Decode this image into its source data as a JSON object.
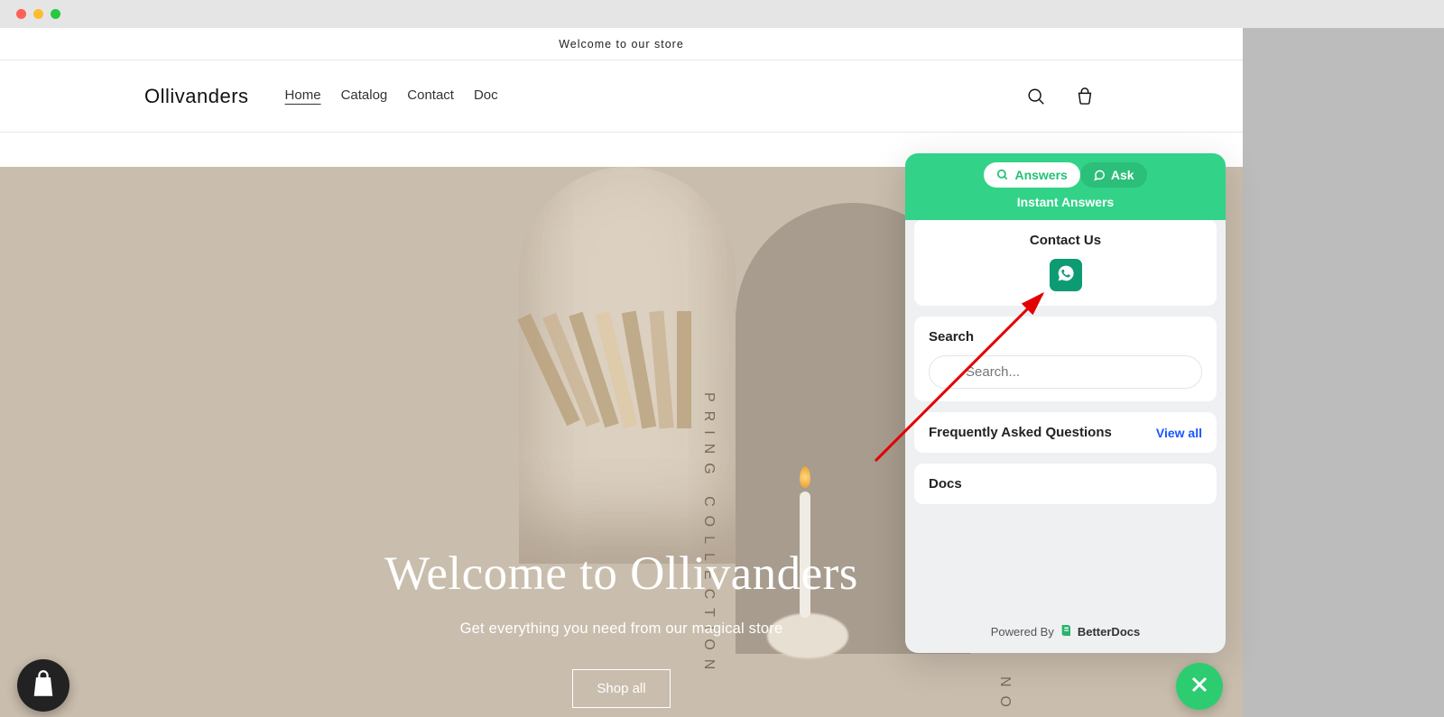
{
  "announce": "Welcome to our store",
  "brand": "Ollivanders",
  "nav": {
    "home": "Home",
    "catalog": "Catalog",
    "contact": "Contact",
    "doc": "Doc"
  },
  "hero": {
    "title": "Welcome to Ollivanders",
    "subtitle": "Get everything you need from our magical store",
    "button": "Shop all",
    "vertical1": "PRING COLLECTION",
    "vertical2": "NO"
  },
  "widget": {
    "tab_answers": "Answers",
    "tab_ask": "Ask",
    "subtitle": "Instant Answers",
    "contact_title": "Contact Us",
    "search_title": "Search",
    "search_placeholder": "Search...",
    "faq_title": "Frequently Asked Questions",
    "view_all": "View all",
    "docs_title": "Docs",
    "powered_by": "Powered By",
    "brand": "BetterDocs"
  }
}
